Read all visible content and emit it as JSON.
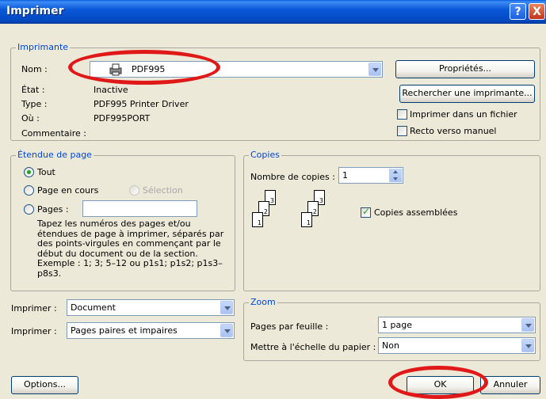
{
  "window": {
    "title": "Imprimer",
    "help_label": "?",
    "close_label": "X"
  },
  "printer": {
    "group_label": "Imprimante",
    "name_label": "Nom :",
    "name_value": "PDF995",
    "state_label": "État :",
    "state_value": "Inactive",
    "type_label": "Type :",
    "type_value": "PDF995 Printer Driver",
    "where_label": "Où :",
    "where_value": "PDF995PORT",
    "comment_label": "Commentaire :",
    "properties_button": "Propriétés...",
    "find_printer_button": "Rechercher une imprimante...",
    "print_to_file_label": "Imprimer dans un fichier",
    "print_to_file_checked": false,
    "manual_duplex_label": "Recto verso manuel",
    "manual_duplex_checked": false
  },
  "page_range": {
    "group_label": "Étendue de page",
    "all_label": "Tout",
    "current_label": "Page en cours",
    "selection_label": "Sélection",
    "pages_label": "Pages :",
    "pages_value": "",
    "selected": "all",
    "help_text": "Tapez les numéros des pages et/ou étendues de page à imprimer, séparés par des points-virgules en commençant par le début du document ou de la section. Exemple : 1; 3; 5–12 ou p1s1; p1s2; p1s3–p8s3."
  },
  "print_what": {
    "label": "Imprimer :",
    "value": "Document"
  },
  "print_pages": {
    "label": "Imprimer :",
    "value": "Pages paires et impaires"
  },
  "copies": {
    "group_label": "Copies",
    "count_label": "Nombre de copies :",
    "count_value": "1",
    "collate_label": "Copies assemblées",
    "collate_checked": true,
    "collate_pages_left": [
      "3",
      "2",
      "1"
    ],
    "collate_pages_right": [
      "3",
      "2",
      "1"
    ]
  },
  "zoom": {
    "group_label": "Zoom",
    "pages_per_sheet_label": "Pages par feuille :",
    "pages_per_sheet_value": "1 page",
    "scale_label": "Mettre à l'échelle du papier :",
    "scale_value": "Non"
  },
  "footer": {
    "options_button": "Options...",
    "ok_button": "OK",
    "cancel_button": "Annuler"
  },
  "colors": {
    "title_bar": "#0a58d8",
    "group_label": "#0046d5",
    "annotation": "#e01818",
    "check_mark": "#21a121"
  }
}
